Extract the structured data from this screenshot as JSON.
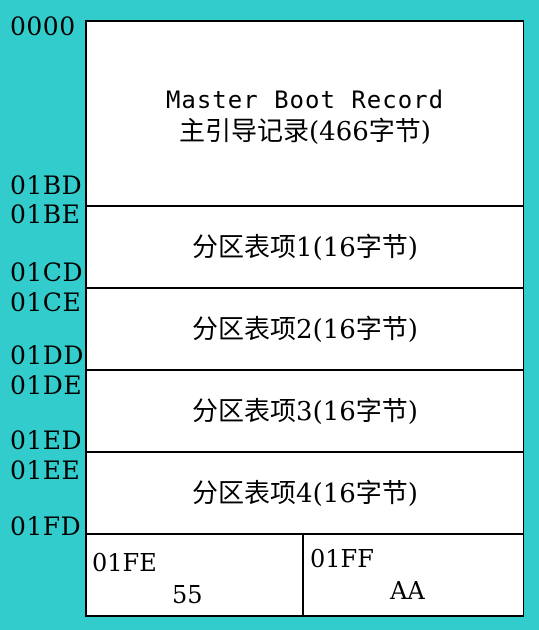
{
  "addresses": {
    "a0000": "0000",
    "a01BD": "01BD",
    "a01BE": "01BE",
    "a01CD": "01CD",
    "a01CE": "01CE",
    "a01DD": "01DD",
    "a01DE": "01DE",
    "a01ED": "01ED",
    "a01EE": "01EE",
    "a01FD": "01FD"
  },
  "mbr": {
    "title_en": "Master Boot Record",
    "title_zh": "主引导记录(466字节)"
  },
  "partitions": [
    "分区表项1(16字节)",
    "分区表项2(16字节)",
    "分区表项3(16字节)",
    "分区表项4(16字节)"
  ],
  "signature": {
    "left_addr": "01FE",
    "left_value": "55",
    "right_addr": "01FF",
    "right_value": "AA"
  },
  "colors": {
    "background": "#33cccc",
    "box": "#ffffff",
    "lines": "#000000"
  }
}
